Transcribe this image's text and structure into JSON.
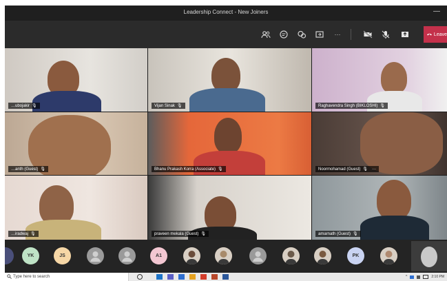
{
  "window": {
    "title": "Leadership Connect - New Joiners",
    "minimize_glyph": "—"
  },
  "toolbar": {
    "icons": [
      "participants-icon",
      "chat-icon",
      "reactions-icon",
      "share-icon",
      "more-icon",
      "camera-off-icon",
      "mic-off-icon",
      "share-tray-icon"
    ],
    "more_label": "···",
    "leave_label": "Leave",
    "leave_color": "#c4314b"
  },
  "tiles": [
    {
      "name": "…ubojakir",
      "bg": "#d9d6d1"
    },
    {
      "name": "Vijan Sinak",
      "bg": "#cfcbc4"
    },
    {
      "name": "Raghavendra Singh (BIKLOSHI)",
      "bg": "#d7c4d6"
    },
    {
      "name": "…anth (Guest)",
      "bg": "#c9b8a5"
    },
    {
      "name": "Bhanu Prakash Korra (Associate)",
      "bg": "#e4683a"
    },
    {
      "name": "Noormohamad (Guest)",
      "bg": "#5a4a44"
    },
    {
      "name": "…iradwaj",
      "bg": "#e3d8d2"
    },
    {
      "name": "praveen mekala (Guest)",
      "bg": "#cfc9c1"
    },
    {
      "name": "amarnath (Guest)",
      "bg": "#9aa2a5"
    }
  ],
  "participants_strip": [
    {
      "initials": "",
      "color": "#4a4f7a",
      "type": "blank"
    },
    {
      "initials": "YK",
      "color": "#bfe3c6",
      "type": "initials"
    },
    {
      "initials": "JS",
      "color": "#f6d7a6",
      "type": "initials"
    },
    {
      "initials": "",
      "color": "#9a9a9a",
      "type": "default"
    },
    {
      "initials": "",
      "color": "#9a9a9a",
      "type": "default"
    },
    {
      "initials": "A1",
      "color": "#f3c7d2",
      "type": "initials"
    },
    {
      "initials": "",
      "color": "#6b4d3b",
      "type": "photo"
    },
    {
      "initials": "",
      "color": "#a88a6a",
      "type": "photo"
    },
    {
      "initials": "",
      "color": "#9a9a9a",
      "type": "default"
    },
    {
      "initials": "",
      "color": "#6b5a4a",
      "type": "photo"
    },
    {
      "initials": "",
      "color": "#7a5a40",
      "type": "photo"
    },
    {
      "initials": "PK",
      "color": "#c9d3f2",
      "type": "initials"
    },
    {
      "initials": "",
      "color": "#b08a70",
      "type": "photo"
    }
  ],
  "taskbar": {
    "search_placeholder": "Type here to search",
    "time": "2:10 PM"
  }
}
